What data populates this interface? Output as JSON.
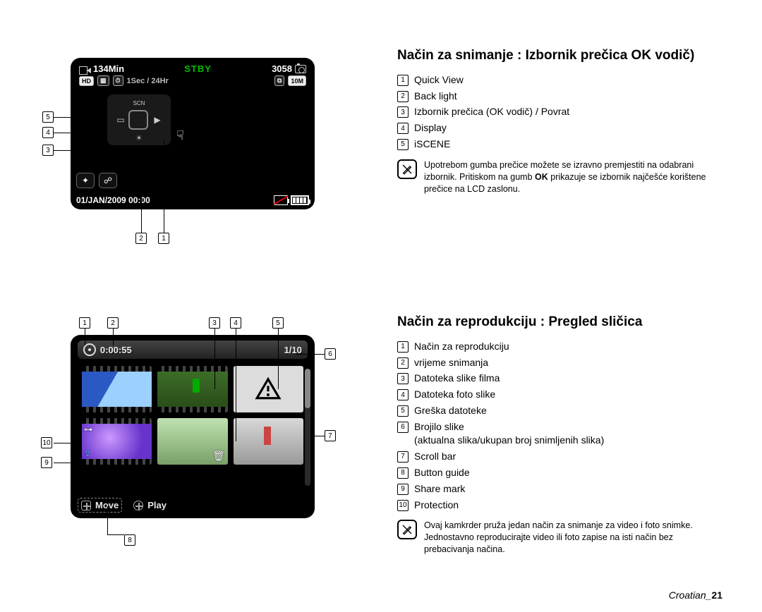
{
  "lcd_record": {
    "rec_time_remaining": "134Min",
    "status": "STBY",
    "photos_remaining": "3058",
    "sec_hr": "1Sec / 24Hr",
    "hd_badge": "HD",
    "quality_badge": "▦",
    "timelapse_badge": "⏱",
    "card_badge": "⧉",
    "mpixel_badge": "10M",
    "scn_label": "SCN",
    "datetime": "01/JAN/2009 00:00"
  },
  "lcd_thumb": {
    "elapsed": "0:00:55",
    "counter": "1/10",
    "move_label": "Move",
    "play_label": "Play",
    "warn_glyph": "!",
    "key_glyph": "⊶",
    "share_glyph": "⇪",
    "trash_glyph": "🗑"
  },
  "section1": {
    "title": "Način za snimanje : Izbornik prečica OK vodič)",
    "items": [
      "Quick View",
      "Back light",
      "Izbornik prečica (OK vodič) / Povrat",
      "Display",
      "iSCENE"
    ],
    "note_pre": "Upotrebom gumba prečice možete se izravno premjestiti na odabrani izbornik. Pritiskom na gumb ",
    "note_bold": "OK",
    "note_post": " prikazuje se izbornik najčešće korištene prečice na LCD zaslonu."
  },
  "section2": {
    "title": "Način za reprodukciju : Pregled sličica",
    "items": [
      "Način za reprodukciju",
      "vrijeme snimanja",
      "Datoteka slike filma",
      "Datoteka foto slike",
      "Greška datoteke",
      "Brojilo slike",
      "Scroll bar",
      "Button guide",
      "Share mark",
      "Protection"
    ],
    "item6_extra": "(aktualna slika/ukupan broj snimljenih slika)",
    "note": "Ovaj kamkrder pruža jedan način za snimanje za video i foto snimke. Jednostavno reproducirajte video ili foto zapise na isti način bez prebacivanja načina."
  },
  "footer": {
    "lang": "Croatian",
    "page": "21"
  }
}
